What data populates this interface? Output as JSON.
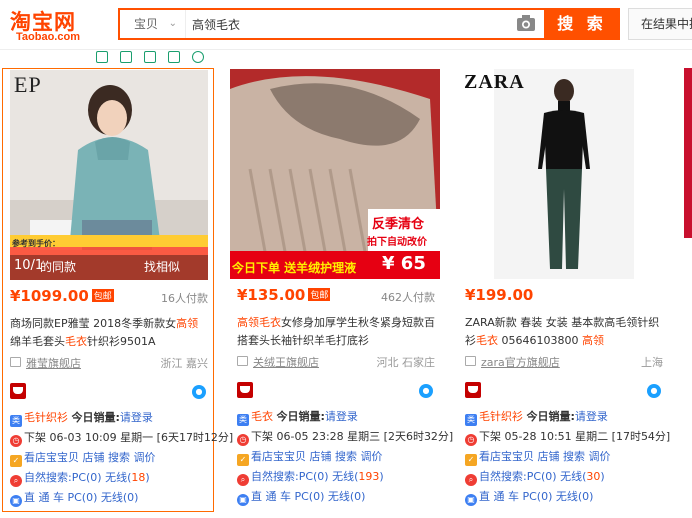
{
  "header": {
    "logo_cn": "淘宝网",
    "logo_en": "Taobao.com",
    "search_scope": "宝贝",
    "search_value": "高领毛衣",
    "search_button": "搜 索",
    "in_result_button": "在结果中搜"
  },
  "items": [
    {
      "img_overlay_left": "10/1",
      "img_btn_left": "的同款",
      "img_btn_right": "找相似",
      "img_brand": "EP",
      "img_promo_text": "参考到手价：",
      "price": "¥1099.00",
      "baoyou": "包邮",
      "sold": "16人付款",
      "title_parts": [
        "商场同款EP雅莹 2018冬季新款女",
        "高领",
        "绵羊毛套头",
        "毛衣",
        "针织衫9501A"
      ],
      "shop": "雅莹旗舰店",
      "location": "浙江 嘉兴",
      "category": "毛针织衫",
      "sales_label": "今日销量:",
      "sales_login": "请登录",
      "listing": "下架 06-03 10:09 星期一 [6天17时12分]",
      "shop_links": "看店宝宝贝 店铺 搜索 调价",
      "natural": "自然搜索:PC(0) 无线(",
      "natural_num": "18",
      "natural_end": ")",
      "direct": "直 通 车 PC(0) 无线(0)"
    },
    {
      "img_sale_badge": "反季清仓",
      "img_sale_sub": "拍下自动改价",
      "img_sale_price": "¥ 65",
      "img_banner": "今日下单 送羊绒护理液",
      "price": "¥135.00",
      "baoyou": "包邮",
      "sold": "462人付款",
      "title_parts": [
        "",
        "高领毛衣",
        "女修身加厚学生秋冬紧身短款百搭套头长袖针织羊毛打底衫",
        "",
        ""
      ],
      "shop": "关绒王旗舰店",
      "location": "河北 石家庄",
      "category": "毛衣",
      "sales_label": "今日销量:",
      "sales_login": "请登录",
      "listing": "下架 06-05 23:28 星期三 [2天6时32分]",
      "shop_links": "看店宝宝贝 店铺 搜索 调价",
      "natural": "自然搜索:PC(0) 无线(",
      "natural_num": "193",
      "natural_end": ")",
      "direct": "直 通 车 PC(0) 无线(0)"
    },
    {
      "img_brand": "ZARA",
      "price": "¥199.00",
      "sold": "",
      "title_parts": [
        "ZARA新款 春装 女装 基本款高毛领针织衫",
        "毛衣",
        " 05646103800 ",
        "高领",
        ""
      ],
      "shop": "zara官方旗舰店",
      "location": "上海",
      "category": "毛针织衫",
      "sales_label": "今日销量:",
      "sales_login": "请登录",
      "listing": "下架 05-28 10:51 星期二 [17时54分]",
      "shop_links": "看店宝宝贝 店铺 搜索 调价",
      "natural": "自然搜索:PC(0) 无线(",
      "natural_num": "30",
      "natural_end": ")",
      "direct": "直 通 车 PC(0) 无线(0)"
    }
  ],
  "colors": {
    "accent": "#ff5000",
    "price": "#ff4400",
    "link": "#3366cc",
    "tmall_red": "#c40000"
  }
}
